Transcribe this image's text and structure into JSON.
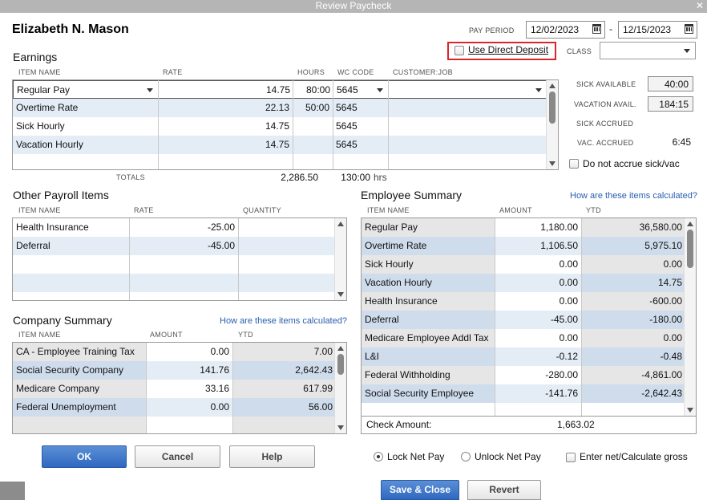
{
  "window": {
    "title": "Review Paycheck",
    "close_glyph": "✕"
  },
  "employee_name": "Elizabeth N. Mason",
  "pay_period": {
    "label": "PAY PERIOD",
    "start": "12/02/2023",
    "separator": "-",
    "end": "12/15/2023"
  },
  "direct_deposit": {
    "label": "Use Direct Deposit",
    "checked": false,
    "highlight_color": "#d9262c"
  },
  "class_field": {
    "label": "CLASS",
    "value": ""
  },
  "earnings": {
    "title": "Earnings",
    "headers": [
      "ITEM NAME",
      "RATE",
      "HOURS",
      "WC CODE",
      "CUSTOMER:JOB"
    ],
    "rows": [
      {
        "item": "Regular Pay",
        "rate": "14.75",
        "hours": "80:00",
        "wc": "5645",
        "job": ""
      },
      {
        "item": "Overtime Rate",
        "rate": "22.13",
        "hours": "50:00",
        "wc": "5645",
        "job": ""
      },
      {
        "item": "Sick Hourly",
        "rate": "14.75",
        "hours": "",
        "wc": "5645",
        "job": ""
      },
      {
        "item": "Vacation Hourly",
        "rate": "14.75",
        "hours": "",
        "wc": "5645",
        "job": ""
      }
    ],
    "totals_label": "TOTALS",
    "totals_amount": "2,286.50",
    "totals_hours": "130:00",
    "totals_unit": "hrs"
  },
  "sick_vacation": {
    "sick_available_label": "SICK AVAILABLE",
    "sick_available": "40:00",
    "vacation_avail_label": "VACATION AVAIL.",
    "vacation_avail": "184:15",
    "sick_accrued_label": "SICK ACCRUED",
    "sick_accrued": "",
    "vac_accrued_label": "VAC. ACCRUED",
    "vac_accrued": "6:45",
    "do_not_accrue_label": "Do not accrue sick/vac"
  },
  "other_payroll": {
    "title": "Other Payroll Items",
    "headers": [
      "ITEM NAME",
      "RATE",
      "QUANTITY"
    ],
    "rows": [
      {
        "item": "Health Insurance",
        "rate": "-25.00",
        "qty": ""
      },
      {
        "item": "Deferral",
        "rate": "-45.00",
        "qty": ""
      }
    ]
  },
  "company_summary": {
    "title": "Company Summary",
    "link": "How are these items calculated?",
    "headers": [
      "ITEM NAME",
      "AMOUNT",
      "YTD"
    ],
    "rows": [
      {
        "item": "CA - Employee Training Tax",
        "amount": "0.00",
        "ytd": "7.00"
      },
      {
        "item": "Social Security Company",
        "amount": "141.76",
        "ytd": "2,642.43"
      },
      {
        "item": "Medicare Company",
        "amount": "33.16",
        "ytd": "617.99"
      },
      {
        "item": "Federal Unemployment",
        "amount": "0.00",
        "ytd": "56.00"
      }
    ]
  },
  "employee_summary": {
    "title": "Employee Summary",
    "link": "How are these items calculated?",
    "headers": [
      "ITEM NAME",
      "AMOUNT",
      "YTD"
    ],
    "rows": [
      {
        "item": "Regular Pay",
        "amount": "1,180.00",
        "ytd": "36,580.00"
      },
      {
        "item": "Overtime Rate",
        "amount": "1,106.50",
        "ytd": "5,975.10"
      },
      {
        "item": "Sick Hourly",
        "amount": "0.00",
        "ytd": "0.00"
      },
      {
        "item": "Vacation Hourly",
        "amount": "0.00",
        "ytd": "14.75"
      },
      {
        "item": "Health Insurance",
        "amount": "0.00",
        "ytd": "-600.00"
      },
      {
        "item": "Deferral",
        "amount": "-45.00",
        "ytd": "-180.00"
      },
      {
        "item": "Medicare Employee Addl Tax",
        "amount": "0.00",
        "ytd": "0.00"
      },
      {
        "item": "L&I",
        "amount": "-0.12",
        "ytd": "-0.48"
      },
      {
        "item": "Federal Withholding",
        "amount": "-280.00",
        "ytd": "-4,861.00"
      },
      {
        "item": "Social Security Employee",
        "amount": "-141.76",
        "ytd": "-2,642.43"
      }
    ],
    "check_amount_label": "Check Amount:",
    "check_amount": "1,663.02"
  },
  "buttons": {
    "ok": "OK",
    "cancel": "Cancel",
    "help": "Help",
    "save_close": "Save & Close",
    "revert": "Revert"
  },
  "net_options": {
    "lock": "Lock Net Pay",
    "unlock": "Unlock Net Pay",
    "selected": "lock",
    "enter_net": "Enter net/Calculate gross"
  },
  "colors": {
    "row_alt": "#e4edf6",
    "primary_button": "#2f68c0",
    "link": "#2a5eb0"
  }
}
